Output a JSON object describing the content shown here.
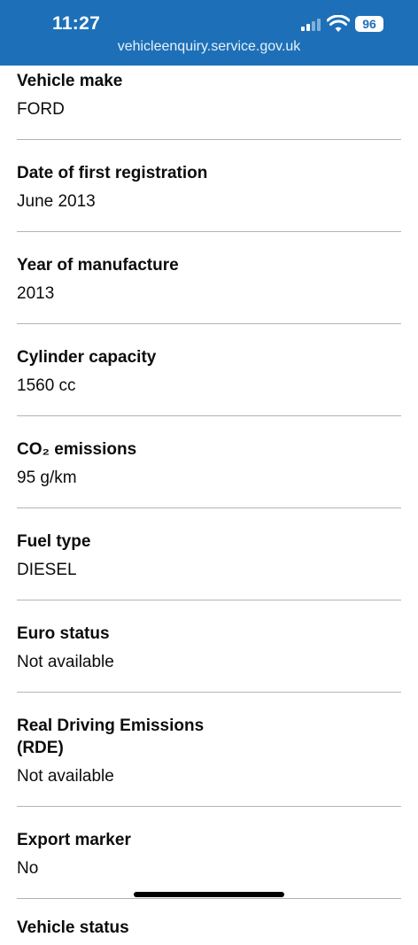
{
  "status_bar": {
    "time": "11:27",
    "battery": "96",
    "url": "vehicleenquiry.service.gov.uk",
    "colors": {
      "background": "#1d70b8"
    },
    "icons": [
      "signal-icon",
      "wifi-icon",
      "battery-icon"
    ]
  },
  "details": [
    {
      "label": "Vehicle make",
      "value": "FORD"
    },
    {
      "label": "Date of first registration",
      "value": "June 2013"
    },
    {
      "label": "Year of manufacture",
      "value": "2013"
    },
    {
      "label": "Cylinder capacity",
      "value": "1560 cc"
    },
    {
      "label": "CO₂ emissions",
      "value": "95 g/km"
    },
    {
      "label": "Fuel type",
      "value": "DIESEL"
    },
    {
      "label": "Euro status",
      "value": "Not available"
    },
    {
      "label": "Real Driving Emissions (RDE)",
      "value": "Not available"
    },
    {
      "label": "Export marker",
      "value": "No"
    },
    {
      "label": "Vehicle status"
    }
  ]
}
